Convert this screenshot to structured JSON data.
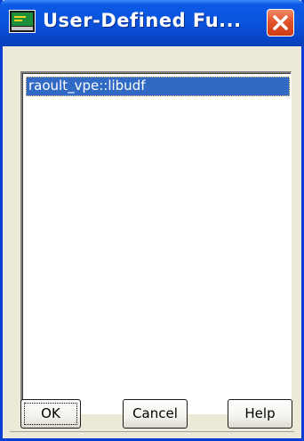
{
  "window": {
    "title": "User-Defined Fu..."
  },
  "title_bar": {
    "icon": "app-window-icon",
    "close_icon": "close-icon"
  },
  "list": {
    "items": [
      {
        "label": "raoult_vpe::libudf",
        "selected": true
      }
    ]
  },
  "buttons": {
    "ok_label": "OK",
    "cancel_label": "Cancel",
    "help_label": "Help"
  },
  "colors": {
    "titlebar": "#0a53dc",
    "selection": "#316ac5",
    "close_button": "#e2542b",
    "dialog_background": "#ece9d8"
  }
}
